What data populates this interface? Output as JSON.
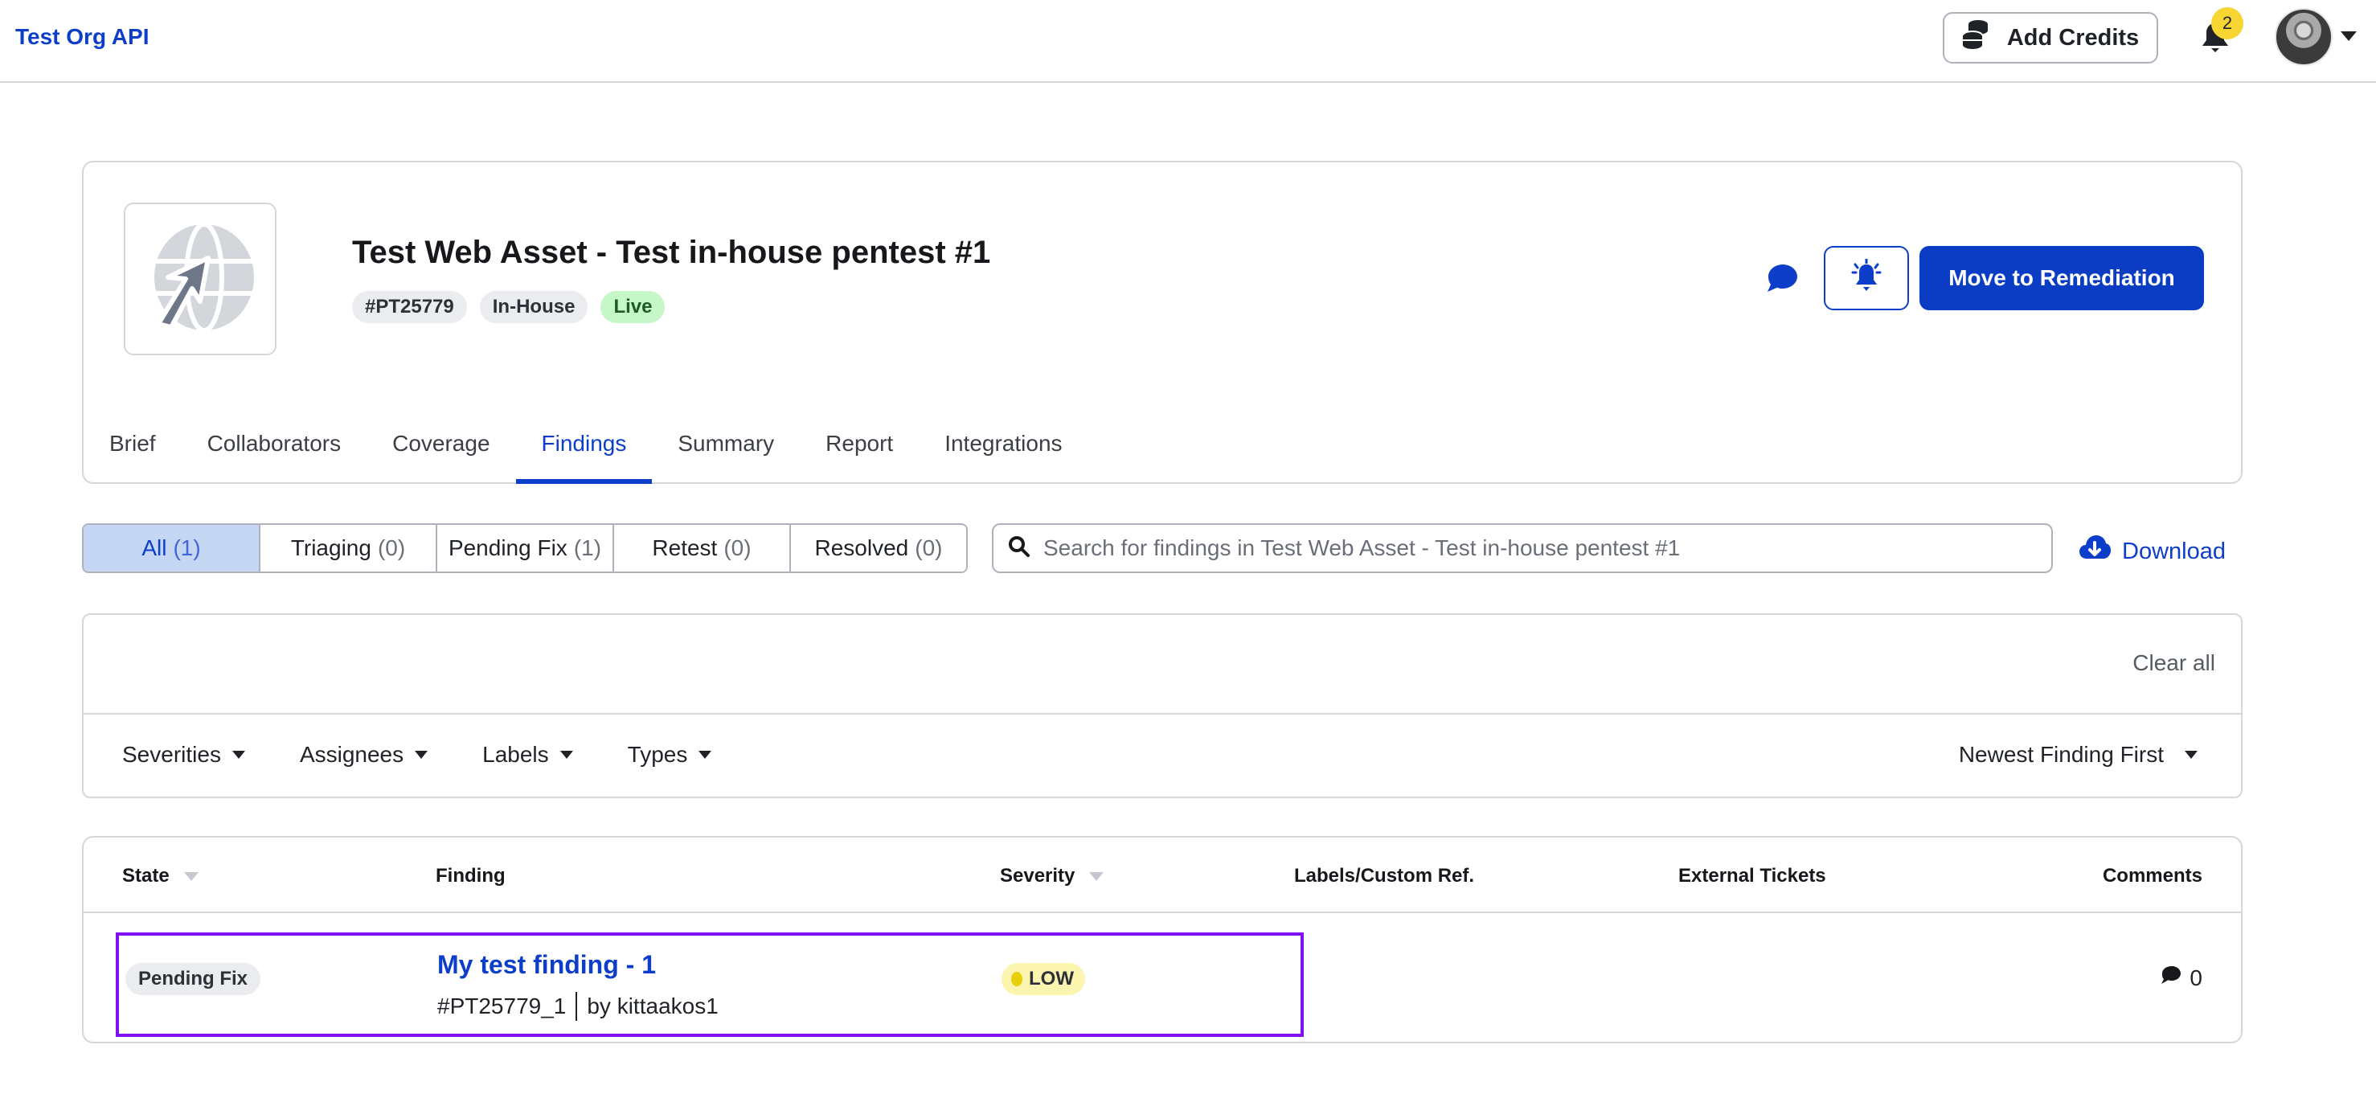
{
  "topbar": {
    "org_name": "Test Org API",
    "add_credits_label": "Add Credits",
    "notification_count": "2",
    "icons": {
      "credits": "coins-icon",
      "notifications": "bell-icon",
      "avatar": "user-avatar",
      "avatar_menu": "caret-down-icon"
    }
  },
  "header": {
    "title": "Test Web Asset - Test in-house pentest #1",
    "tags": [
      {
        "label": "#PT25779",
        "kind": "id"
      },
      {
        "label": "In-House",
        "kind": "type"
      },
      {
        "label": "Live",
        "kind": "status"
      }
    ],
    "primary_action_label": "Move to Remediation",
    "icons": {
      "asset_logo": "web-asset-globe-cursor-icon",
      "chat": "comment-icon",
      "alerts": "alert-bell-icon"
    },
    "colors": {
      "accent": "#0a3cc4",
      "live_bg": "#c6f7c9"
    }
  },
  "tabs": [
    {
      "label": "Brief",
      "active": false
    },
    {
      "label": "Collaborators",
      "active": false
    },
    {
      "label": "Coverage",
      "active": false
    },
    {
      "label": "Findings",
      "active": true
    },
    {
      "label": "Summary",
      "active": false
    },
    {
      "label": "Report",
      "active": false
    },
    {
      "label": "Integrations",
      "active": false
    }
  ],
  "status_filter": [
    {
      "label": "All",
      "count": "(1)",
      "active": true
    },
    {
      "label": "Triaging",
      "count": "(0)",
      "active": false
    },
    {
      "label": "Pending Fix",
      "count": "(1)",
      "active": false
    },
    {
      "label": "Retest",
      "count": "(0)",
      "active": false
    },
    {
      "label": "Resolved",
      "count": "(0)",
      "active": false
    }
  ],
  "search": {
    "placeholder": "Search for findings in Test Web Asset - Test in-house pentest #1",
    "value": ""
  },
  "download_label": "Download",
  "filters": {
    "clear_all_label": "Clear all",
    "dropdowns": [
      "Severities",
      "Assignees",
      "Labels",
      "Types"
    ],
    "sort_selected": "Newest Finding First"
  },
  "table": {
    "columns": [
      "State",
      "Finding",
      "Severity",
      "Labels/Custom Ref.",
      "External Tickets",
      "Comments"
    ],
    "rows": [
      {
        "state": "Pending Fix",
        "title": "My test finding - 1",
        "id": "#PT25779_1",
        "author": "by kittaakos1",
        "severity": "LOW",
        "labels": "",
        "external_tickets": "",
        "comments": "0"
      }
    ]
  }
}
